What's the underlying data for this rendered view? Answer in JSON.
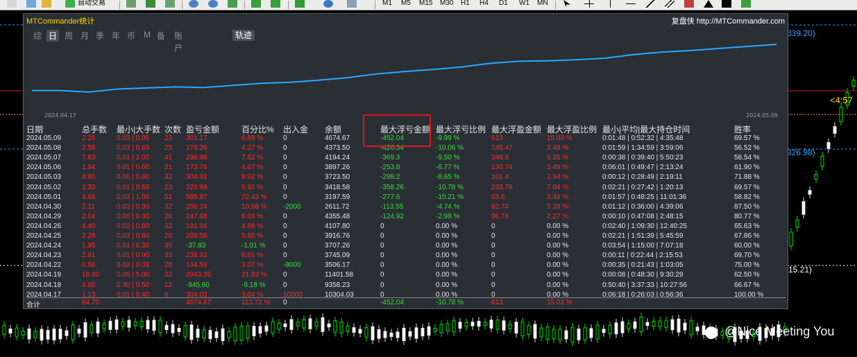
{
  "toolbar": {
    "auto_trade_label": "自动交易",
    "timeframes": [
      "M1",
      "M5",
      "M15",
      "M30",
      "H1",
      "H4",
      "D1",
      "W1",
      "MN"
    ]
  },
  "panel": {
    "title": "MTCommander统计",
    "right_label": "复盘侠 http://MTCommander.com",
    "tabs": [
      "综",
      "日",
      "周",
      "月",
      "季",
      "年",
      "币",
      "M",
      "备",
      "账户"
    ],
    "active_tab": "日",
    "track_tab": "轨迹",
    "date_start": "2024.04.17",
    "date_end": "2024.05.09"
  },
  "axis_labels": [
    "339.20)",
    "326.98)",
    "15.21)",
    "<4:57"
  ],
  "table": {
    "headers": [
      "日期",
      "总手数",
      "最小|大手数",
      "次数",
      "盈亏金额",
      "百分比%",
      "出入金",
      "余额",
      "最大浮亏金额",
      "最大浮亏比例",
      "最大浮盈金额",
      "最大浮盈比例",
      "最小|平均|最大持仓时间",
      "胜率"
    ],
    "rows": [
      [
        "2024.05.09",
        "2.28",
        "0.03 | 0.95",
        "23",
        "301.17",
        "6.89 %",
        "0",
        "4674.67",
        "-452.04",
        "-9.99 %",
        "613",
        "15.03 %",
        "0:01:48 | 0:52:32 | 4:35:48",
        "69.57 %"
      ],
      [
        "2024.05.08",
        "2.58",
        "0.03 | 0.63",
        "23",
        "179.26",
        "4.27 %",
        "0",
        "4373.50",
        "-420.34",
        "-10.06 %",
        "145.47",
        "3.48 %",
        "0:01:59 | 1:34:59 | 3:59:06",
        "56.52 %"
      ],
      [
        "2024.05.07",
        "7.83",
        "0.01 | 2.00",
        "41",
        "296.98",
        "7.62 %",
        "0",
        "4194.24",
        "-369.3",
        "-9.50 %",
        "346.5",
        "9.25 %",
        "0:00:38 | 0:39:40 | 5:50:23",
        "58.54 %"
      ],
      [
        "2024.05.06",
        "1.94",
        "0.01 | 0.60",
        "21",
        "173.76",
        "4.67 %",
        "0",
        "3897.26",
        "-253.8",
        "-6.77 %",
        "130.74",
        "3.49 %",
        "0:06:01 | 0:49:47 | 2:13:24",
        "61.90 %"
      ],
      [
        "2024.05.03",
        "4.80",
        "0.06 | 0.60",
        "32",
        "304.92",
        "8.92 %",
        "0",
        "3723.50",
        "-298.2",
        "-8.65 %",
        "101.4",
        "2.94 %",
        "0:00:12 | 0:28:49 | 2:19:11",
        "71.88 %"
      ],
      [
        "2024.05.02",
        "2.33",
        "0.01 | 0.60",
        "23",
        "220.99",
        "6.91 %",
        "0",
        "3418.58",
        "-358.26",
        "-10.78 %",
        "233.76",
        "7.04 %",
        "0:02:21 | 0:27:42 | 1:20:13",
        "69.57 %"
      ],
      [
        "2024.05.01",
        "4.66",
        "0.03 | 1.00",
        "51",
        "585.87",
        "22.43 %",
        "0",
        "3197.59",
        "-277.6",
        "-10.21 %",
        "93.6",
        "3.44 %",
        "0:01:57 | 0:48:25 | 11:01:36",
        "58.82 %"
      ],
      [
        "2024.04.30",
        "2.11",
        "0.03 | 0.30",
        "32",
        "256.24",
        "10.88 %",
        "-2000",
        "2611.72",
        "-113.55",
        "-4.74 %",
        "82.74",
        "3.28 %",
        "0:01:12 | 0:36:00 | 4:39:06",
        "87.50 %"
      ],
      [
        "2024.04.29",
        "2.04",
        "0.06 | 0.30",
        "26",
        "247.68",
        "6.03 %",
        "0",
        "4355.48",
        "-124.92",
        "-2.99 %",
        "96.78",
        "2.27 %",
        "0:00:10 | 0:47:08 | 2:48:15",
        "80.77 %"
      ],
      [
        "2024.04.26",
        "4.40",
        "0.02 | 0.80",
        "32",
        "191.04",
        "4.88 %",
        "0",
        "4107.80",
        "0",
        "0.00 %",
        "0",
        "0.00 %",
        "0:02:40 | 1:09:30 | 12:40:25",
        "65.63 %"
      ],
      [
        "2024.04.25",
        "2.28",
        "0.03 | 0.60",
        "28",
        "209.50",
        "5.65 %",
        "0",
        "3916.76",
        "0",
        "0.00 %",
        "0",
        "0.00 %",
        "0:02:21 | 1:51:39 | 5:45:59",
        "67.86 %"
      ],
      [
        "2024.04.24",
        "1.95",
        "0.01 | 0.30",
        "35",
        "-37.83",
        "-1.01 %",
        "0",
        "3707.26",
        "0",
        "0.00 %",
        "0",
        "0.00 %",
        "0:03:54 | 1:15:00 | 7:07:18",
        "60.00 %"
      ],
      [
        "2024.04.23",
        "2.81",
        "0.01 | 0.90",
        "33",
        "238.92",
        "6.81 %",
        "0",
        "3745.09",
        "0",
        "0.00 %",
        "0",
        "0.00 %",
        "0:00:11 | 0:22:44 | 2:15:53",
        "69.70 %"
      ],
      [
        "2024.04.22",
        "0.56",
        "0.02 | 0.03",
        "20",
        "104.59",
        "3.07 %",
        "-8000",
        "3506.17",
        "0",
        "0.00 %",
        "0",
        "0.00 %",
        "0:00:35 | 0:21:43 | 1:03:05",
        "75.00 %"
      ],
      [
        "2024.04.19",
        "16.40",
        "0.05 | 5.00",
        "32",
        "2043.35",
        "21.83 %",
        "0",
        "11401.58",
        "0",
        "0.00 %",
        "0",
        "0.00 %",
        "0:00:08 | 0:48:30 | 9:30:29",
        "62.50 %"
      ],
      [
        "2024.04.18",
        "4.60",
        "0.30 | 0.50",
        "12",
        "-945.80",
        "-9.18 %",
        "0",
        "9358.23",
        "0",
        "0.00 %",
        "0",
        "0.00 %",
        "0:50:40 | 3:37:33 | 10:27:56",
        "66.67 %"
      ],
      [
        "2024.04.17",
        "1.13",
        "0.01 | 0.40",
        "6",
        "304.03",
        "3.04 %",
        "10000",
        "10304.03",
        "0",
        "0.00 %",
        "0",
        "0.00 %",
        "0:06:18 | 0:26:03 | 0:56:36",
        "100.00 %"
      ]
    ],
    "total": [
      "合计",
      "64.70",
      "",
      "",
      "4674.67",
      "113.72 %",
      "0",
      "",
      "-452.04",
      "-10.78 %",
      "613",
      "15.03 %",
      "",
      ""
    ]
  },
  "equity_curve": [
    0.1,
    0.1,
    0.07,
    0.13,
    0.15,
    0.17,
    0.16,
    0.2,
    0.24,
    0.26,
    0.3,
    0.35,
    0.42,
    0.47,
    0.51,
    0.56,
    0.63,
    0.67,
    0.68,
    0.7,
    0.73,
    0.8,
    0.85,
    0.88,
    0.92,
    0.96,
    1.0
  ],
  "watermark": "@Nice  Meeting You"
}
